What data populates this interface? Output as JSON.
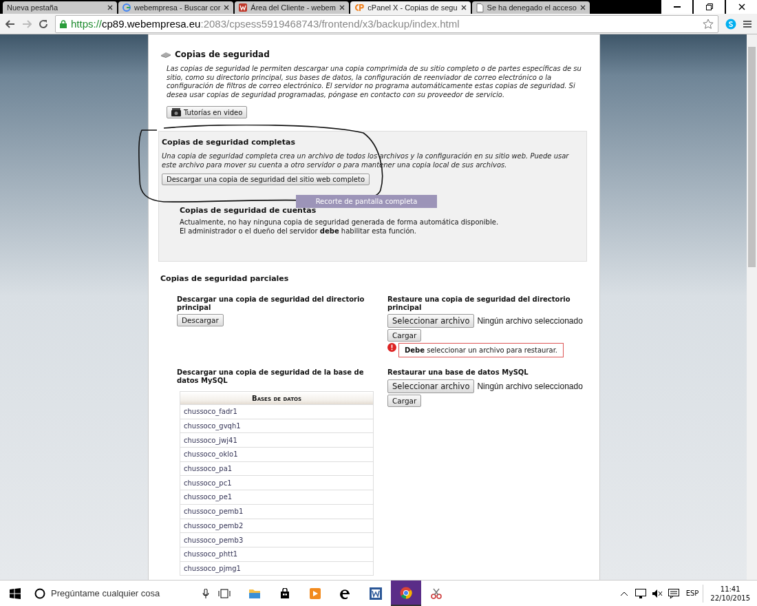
{
  "browser": {
    "tabs": [
      {
        "title": "Nueva pestaña",
        "kind": "blank",
        "selected": false
      },
      {
        "title": "webempresa - Buscar cor",
        "kind": "google",
        "selected": false
      },
      {
        "title": "Área del Cliente - webem",
        "kind": "webempresa",
        "selected": false
      },
      {
        "title": "cPanel X - Copias de segu",
        "kind": "cpanel",
        "selected": true
      },
      {
        "title": "Se ha denegado el acceso",
        "kind": "doc",
        "selected": false
      }
    ],
    "url": {
      "scheme": "https://",
      "host": "cp89.webempresa.eu",
      "rest": ":2083/cpsess5919468743/frontend/x3/backup/index.html"
    }
  },
  "page": {
    "backup": {
      "title": "Copias de seguridad",
      "description": "Las copias de seguridad le permiten descargar una copia comprimida de su sitio completo o de partes específicas de su sitio, como su directorio principal, sus bases de datos, la configuración de reenviador de correo electrónico o la configuración de filtros de correo electrónico. El servidor no programa automáticamente estas copias de seguridad. Si desea usar copias de seguridad programadas, póngase en contacto con su proveedor de servicio.",
      "video_button": "Tutorías en video"
    },
    "full": {
      "title": "Copias de seguridad completas",
      "description": "Una copia de seguridad completa crea un archivo de todos los archivos y la configuración en su sitio web. Puede usar este archivo para mover su cuenta a otro servidor o para mantener una copia local de sus archivos.",
      "button": "Descargar una copia de seguridad del sitio web completo",
      "accounts_title": "Copias de seguridad de cuentas",
      "accounts_text": "Actualmente, no hay ninguna copia de seguridad generada de forma automática disponible. El administrador o el dueño del servidor **debe** habilitar esta función."
    },
    "snip_tooltip": "Recorte de pantalla completa",
    "partial": {
      "title": "Copias de seguridad parciales",
      "home_download": {
        "title": "Descargar una copia de seguridad del directorio principal",
        "button": "Descargar"
      },
      "home_restore": {
        "title": "Restaure una copia de seguridad del directorio principal",
        "choose": "Seleccionar archivo",
        "status": "Ningún archivo seleccionado",
        "upload": "Cargar",
        "error": "**Debe** seleccionar un archivo para restaurar."
      },
      "db_download": {
        "title": "Descargar una copia de seguridad de la base de datos MySQL",
        "table_heading": "Bases de datos",
        "databases": [
          "chussoco_fadr1",
          "chussoco_gvqh1",
          "chussoco_jwj41",
          "chussoco_oklo1",
          "chussoco_pa1",
          "chussoco_pc1",
          "chussoco_pe1",
          "chussoco_pemb1",
          "chussoco_pemb2",
          "chussoco_pemb3",
          "chussoco_phtt1",
          "chussoco_pjmg1"
        ]
      },
      "db_restore": {
        "title": "Restaurar una base de datos MySQL",
        "choose": "Seleccionar archivo",
        "status": "Ningún archivo seleccionado",
        "upload": "Cargar"
      }
    }
  },
  "taskbar": {
    "search": "Pregúntame cualquier cosa",
    "apps": [
      {
        "kind": "folder",
        "active": false
      },
      {
        "kind": "store",
        "active": false
      },
      {
        "kind": "media",
        "active": false
      },
      {
        "kind": "edge",
        "active": false
      },
      {
        "kind": "word",
        "active": false
      },
      {
        "kind": "chrome",
        "active": true
      },
      {
        "kind": "snip",
        "active": false
      }
    ],
    "language": "ESP",
    "time": "11:41",
    "date": "22/10/2015"
  }
}
